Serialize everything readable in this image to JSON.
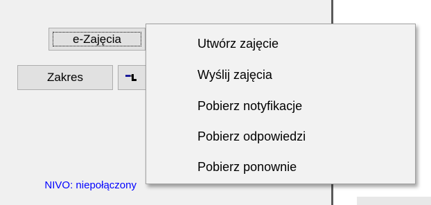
{
  "buttons": {
    "e_zajecia": "e-Zajęcia",
    "zakres": "Zakres"
  },
  "status": {
    "text": "NIVO: niepołączony",
    "color": "#0000ff"
  },
  "menu": {
    "items": [
      {
        "label": "Utwórz zajęcie"
      },
      {
        "label": "Wyślij zajęcia"
      },
      {
        "label": "Pobierz notyfikacje"
      },
      {
        "label": "Pobierz odpowiedzi"
      },
      {
        "label": "Pobierz ponownie"
      }
    ]
  },
  "icons": {
    "tool_icon": "tool-icon"
  }
}
